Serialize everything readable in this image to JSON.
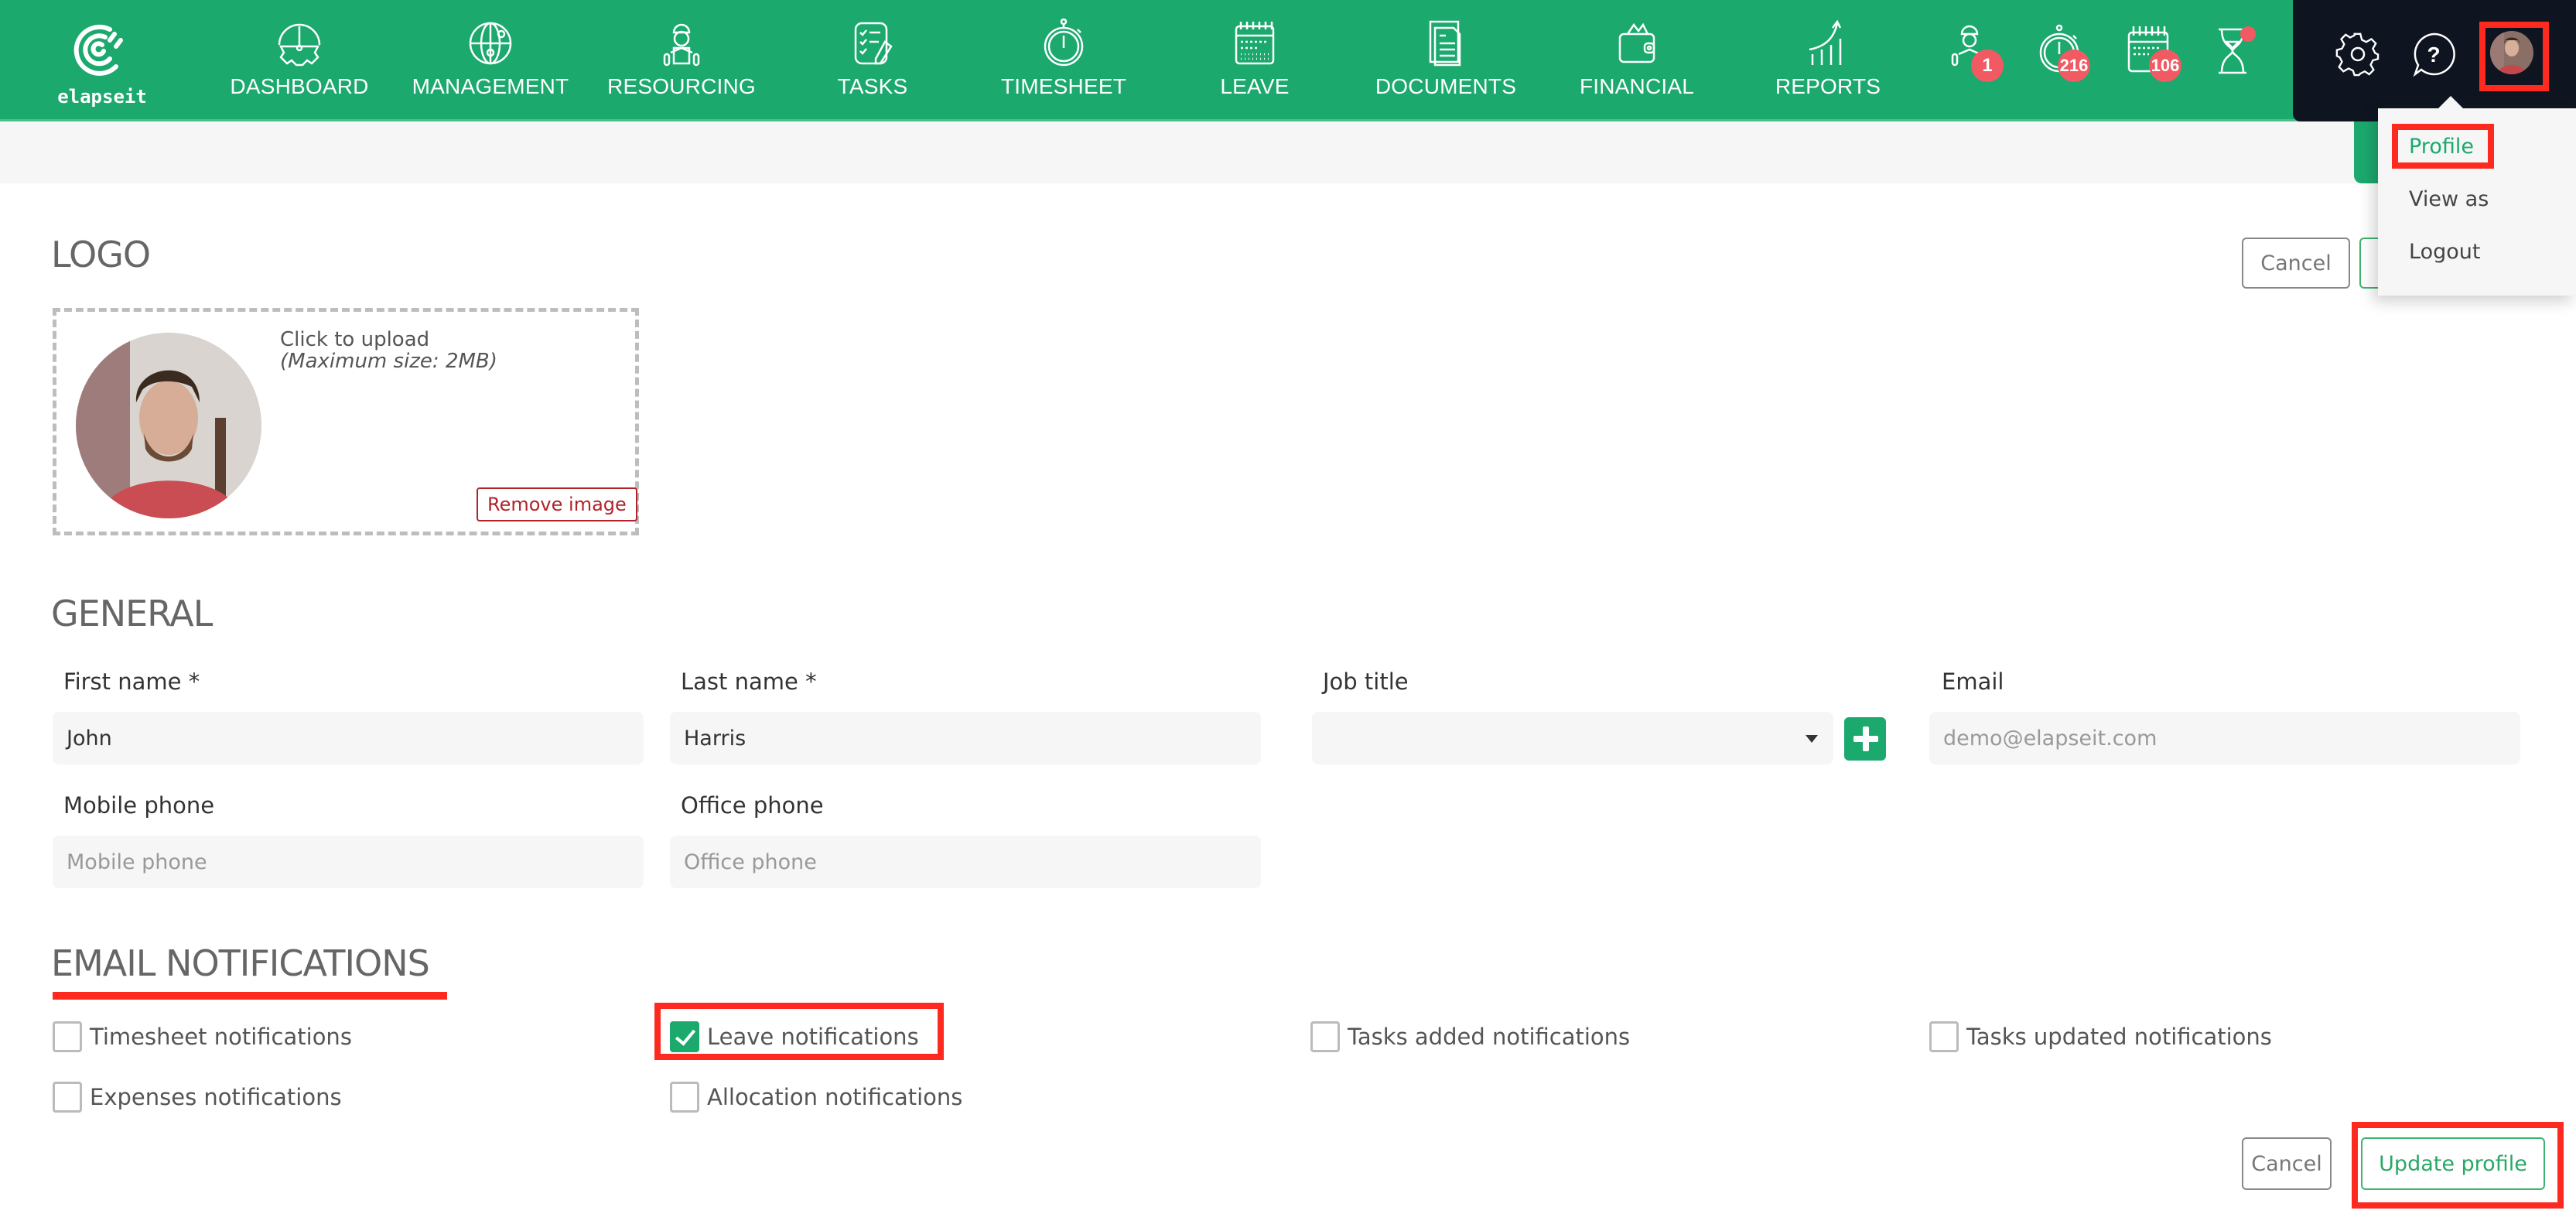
{
  "brand": {
    "name": "elapseit",
    "color": "#1BA96E"
  },
  "nav": {
    "items": [
      {
        "label": "DASHBOARD",
        "icon": "dashboard-gauge-icon"
      },
      {
        "label": "MANAGEMENT",
        "icon": "globe-icon"
      },
      {
        "label": "RESOURCING",
        "icon": "worker-icon"
      },
      {
        "label": "TASKS",
        "icon": "checklist-icon"
      },
      {
        "label": "TIMESHEET",
        "icon": "stopwatch-icon"
      },
      {
        "label": "LEAVE",
        "icon": "calendar-icon"
      },
      {
        "label": "DOCUMENTS",
        "icon": "documents-icon"
      },
      {
        "label": "FINANCIAL",
        "icon": "wallet-icon"
      },
      {
        "label": "REPORTS",
        "icon": "chart-growth-icon"
      }
    ],
    "alerts": [
      {
        "icon": "resourcing-alert-icon",
        "count": "1"
      },
      {
        "icon": "timesheet-alert-icon",
        "count": "216"
      },
      {
        "icon": "leave-alert-icon",
        "count": "106"
      },
      {
        "icon": "hourglass-alert-icon",
        "count": ""
      }
    ],
    "badge_color": "#F25A63"
  },
  "user_menu": {
    "items": [
      {
        "label": "Profile",
        "active": true
      },
      {
        "label": "View as"
      },
      {
        "label": "Logout"
      }
    ]
  },
  "logo_section": {
    "title": "LOGO",
    "upload_text": "Click to upload",
    "upload_hint": "(Maximum size: 2MB)",
    "remove_label": "Remove image",
    "cancel_label": "Cancel"
  },
  "general": {
    "title": "GENERAL",
    "first_name": {
      "label": "First name *",
      "value": "John"
    },
    "last_name": {
      "label": "Last name *",
      "value": "Harris"
    },
    "job_title": {
      "label": "Job title",
      "value": ""
    },
    "email": {
      "label": "Email",
      "placeholder": "demo@elapseit.com"
    },
    "mobile_phone": {
      "label": "Mobile phone",
      "placeholder": "Mobile phone"
    },
    "office_phone": {
      "label": "Office phone",
      "placeholder": "Office phone"
    }
  },
  "notifications": {
    "title": "EMAIL NOTIFICATIONS",
    "items": [
      {
        "label": "Timesheet notifications",
        "checked": false
      },
      {
        "label": "Leave notifications",
        "checked": true
      },
      {
        "label": "Tasks added notifications",
        "checked": false
      },
      {
        "label": "Tasks updated notifications",
        "checked": false
      },
      {
        "label": "Expenses notifications",
        "checked": false
      },
      {
        "label": "Allocation notifications",
        "checked": false
      }
    ]
  },
  "footer": {
    "cancel_label": "Cancel",
    "update_label": "Update profile"
  }
}
